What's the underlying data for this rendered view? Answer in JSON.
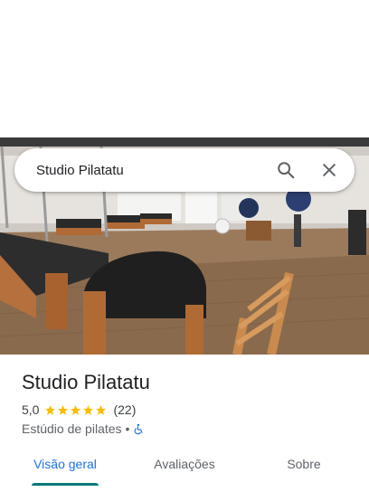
{
  "search": {
    "query": "Studio Pilatatu"
  },
  "place": {
    "name": "Studio Pilatatu",
    "rating": "5,0",
    "stars": 5,
    "review_count": "(22)",
    "category": "Estúdio de pilates",
    "separator": "•"
  },
  "tabs": [
    {
      "label": "Visão geral",
      "active": true
    },
    {
      "label": "Avaliações",
      "active": false
    },
    {
      "label": "Sobre",
      "active": false
    }
  ],
  "colors": {
    "accent": "#1a73e8",
    "star": "#fbbc04",
    "tab_indicator": "#0b7a7a",
    "accessibility_icon": "#1a73e8"
  },
  "icons": {
    "search": "search-icon",
    "close": "close-icon",
    "accessibility": "wheelchair-icon",
    "star": "star-icon"
  }
}
